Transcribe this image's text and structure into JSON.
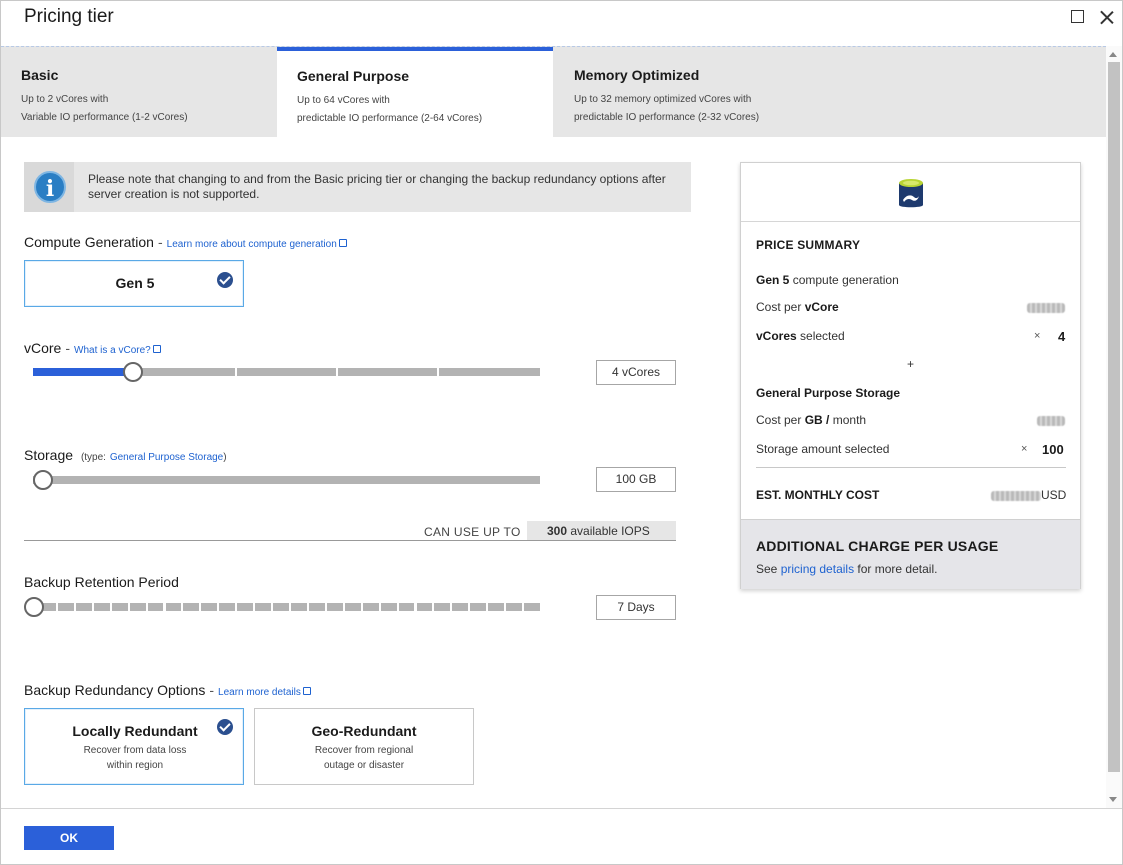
{
  "window": {
    "title": "Pricing tier"
  },
  "tabs": [
    {
      "title": "Basic",
      "desc1": "Up to 2 vCores with",
      "desc2": "Variable IO performance (1-2 vCores)",
      "active": false
    },
    {
      "title": "General Purpose",
      "desc1": "Up to 64 vCores with",
      "desc2": "predictable IO performance (2-64 vCores)",
      "active": true
    },
    {
      "title": "Memory Optimized",
      "desc1": "Up to 32 memory optimized vCores with",
      "desc2": "predictable IO performance (2-32 vCores)",
      "active": false
    }
  ],
  "info": {
    "text": "Please note that changing to and from the Basic pricing tier or changing the backup redundancy options after server creation is not supported."
  },
  "compute": {
    "label": "Compute Generation",
    "link": "Learn more about compute generation",
    "option": "Gen 5"
  },
  "vcore": {
    "label": "vCore",
    "link": "What is a vCore?",
    "value": "4 vCores",
    "fill_fraction": 0.2
  },
  "storage": {
    "label": "Storage",
    "type_prefix": "(type:",
    "type_link": "General Purpose Storage",
    "type_suffix": ")",
    "value": "100 GB",
    "fill_fraction": 0.0
  },
  "iops": {
    "label": "CAN USE UP TO",
    "value": "300",
    "suffix": "available IOPS"
  },
  "backup_retention": {
    "label": "Backup Retention Period",
    "value": "7 Days",
    "fill_fraction": 0.0
  },
  "backup_redundancy": {
    "label": "Backup Redundancy Options",
    "link": "Learn more details",
    "options": [
      {
        "title": "Locally Redundant",
        "sub1": "Recover from data loss",
        "sub2": "within region",
        "selected": true
      },
      {
        "title": "Geo-Redundant",
        "sub1": "Recover from regional",
        "sub2": "outage or disaster",
        "selected": false
      }
    ]
  },
  "summary": {
    "title": "PRICE SUMMARY",
    "gen_bold": "Gen 5",
    "gen_rest": "compute generation",
    "cost_vcore_prefix": "Cost per",
    "cost_vcore_bold": "vCore",
    "vcores_bold": "vCores",
    "vcores_rest": "selected",
    "times": "×",
    "vcores_count": "4",
    "plus": "+",
    "storage_heading": "General Purpose Storage",
    "cost_gb_prefix": "Cost per",
    "cost_gb_bold": "GB /",
    "cost_gb_rest": "month",
    "storage_amount_label": "Storage amount selected",
    "storage_amount": "100",
    "est_label": "EST. MONTHLY COST",
    "currency": "USD"
  },
  "additional": {
    "title": "ADDITIONAL CHARGE PER USAGE",
    "prefix": "See",
    "link": "pricing details",
    "suffix": "for more detail."
  },
  "footer": {
    "ok_label": "OK"
  },
  "colors": {
    "accent": "#2b60d9",
    "link": "#1e62d0",
    "selected_border": "#5aa9e6"
  }
}
